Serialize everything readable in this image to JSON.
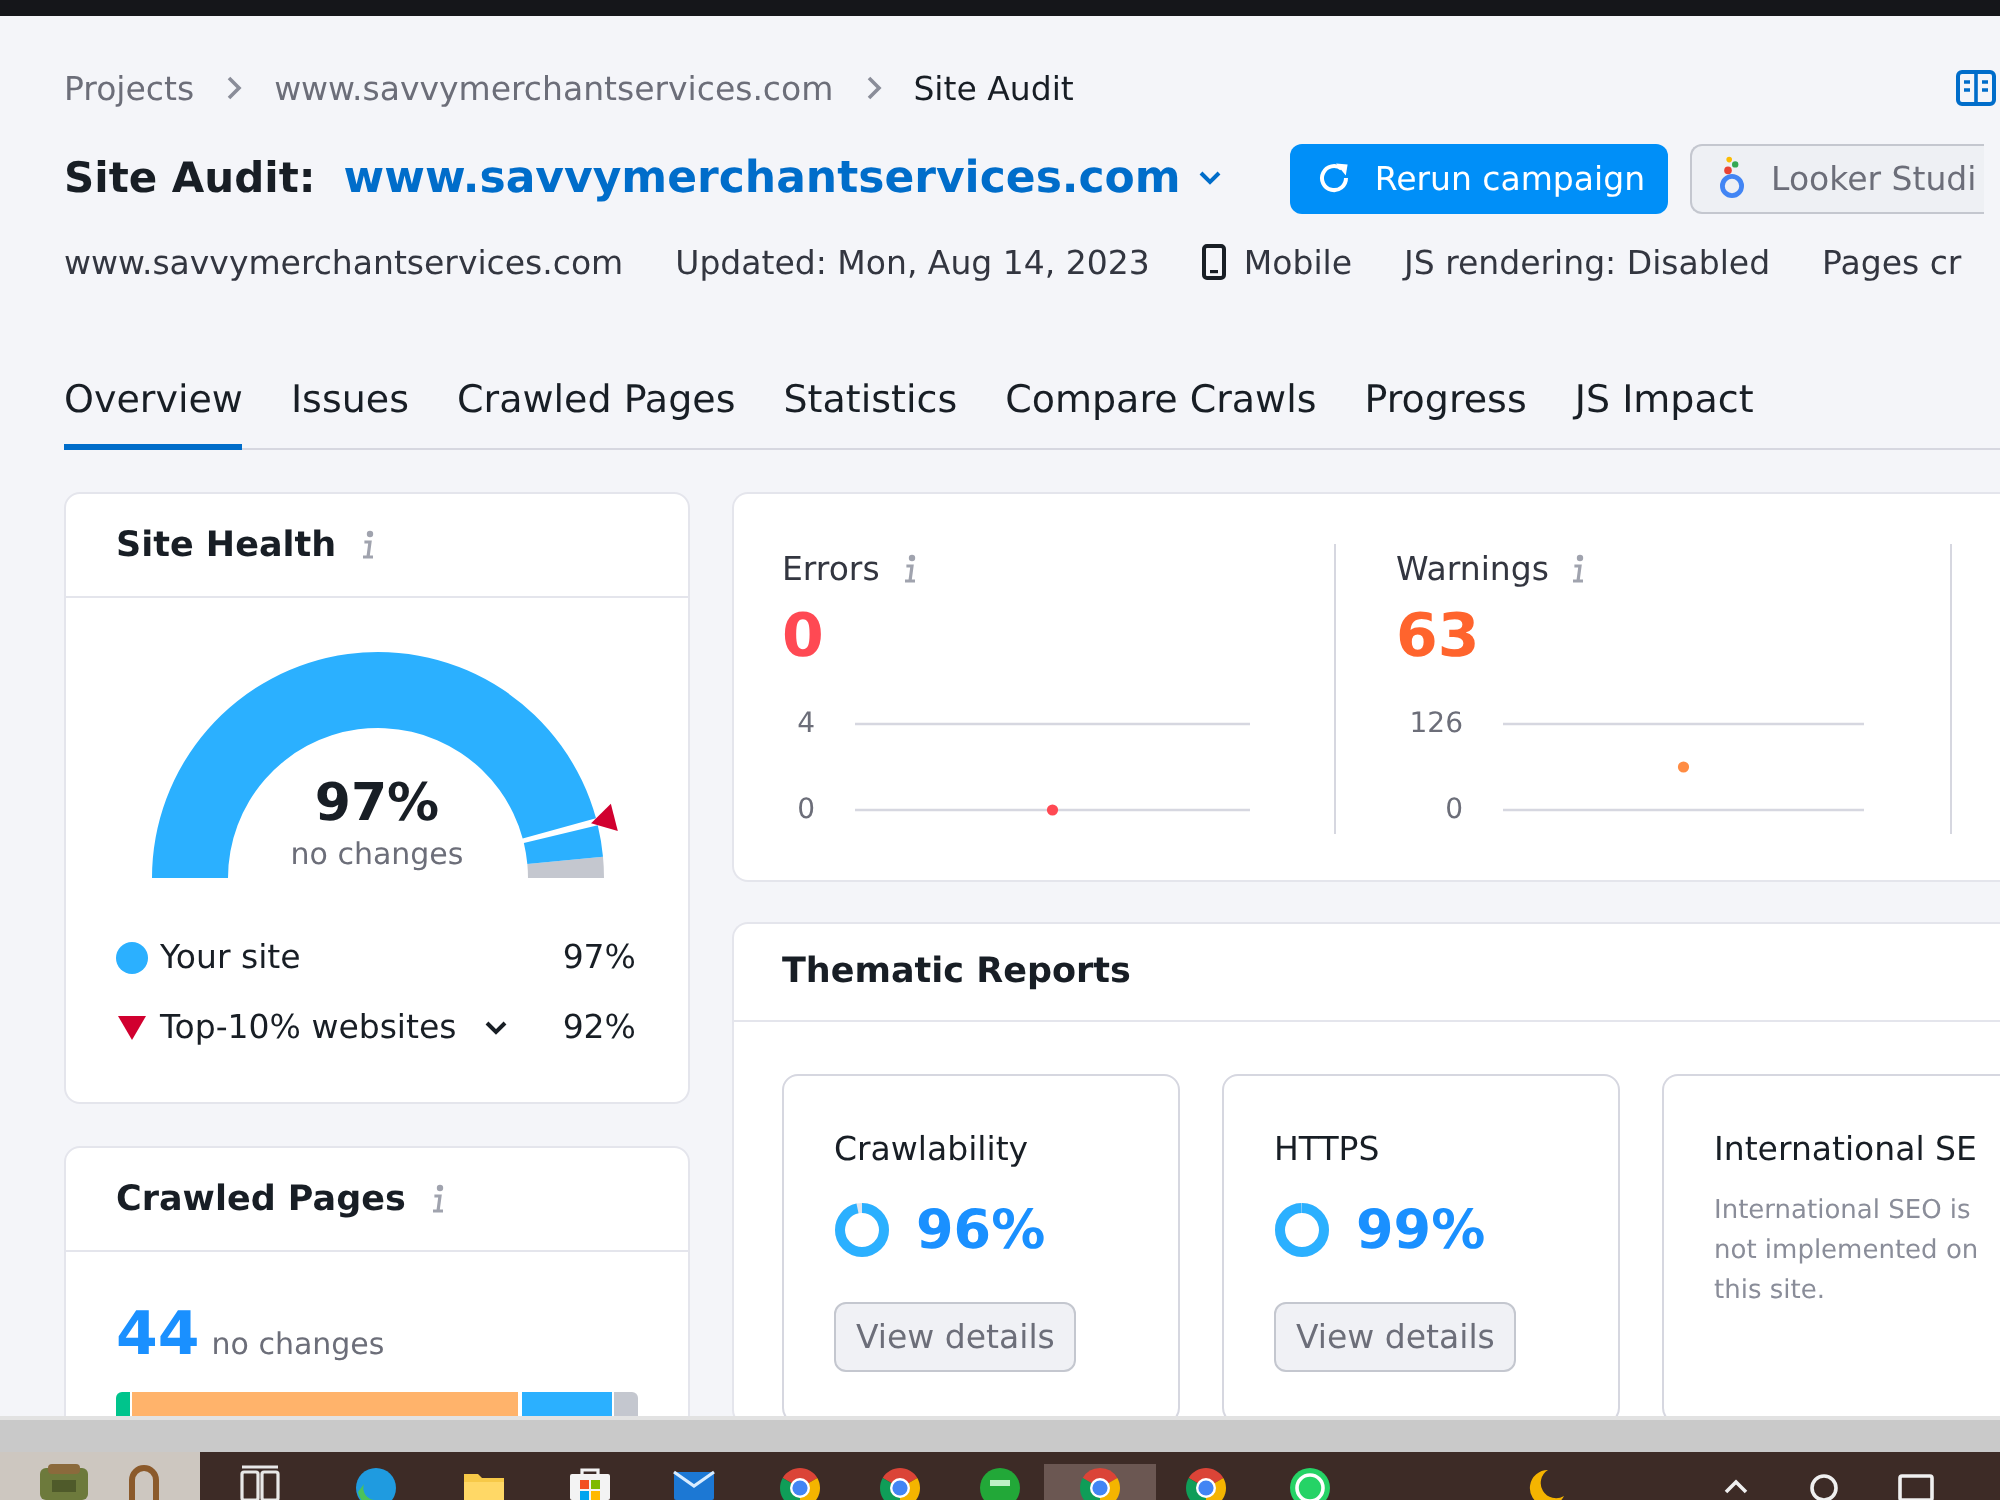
{
  "breadcrumb": [
    {
      "label": "Projects",
      "current": false
    },
    {
      "label": "www.savvymerchantservices.com",
      "current": false
    },
    {
      "label": "Site Audit",
      "current": true
    }
  ],
  "header": {
    "title": "Site Audit:",
    "project": "www.savvymerchantservices.com",
    "buttons": [
      {
        "label": "Rerun campaign",
        "kind": "primary"
      },
      {
        "label": "Looker Studi",
        "kind": "secondary"
      }
    ]
  },
  "meta": [
    {
      "text": "www.savvymerchantservices.com",
      "kind": "text"
    },
    {
      "text": "Updated: Mon, Aug 14, 2023",
      "kind": "text"
    },
    {
      "text": "Mobile",
      "kind": "device"
    },
    {
      "text": "JS rendering: Disabled",
      "kind": "text"
    },
    {
      "text": "Pages cr",
      "kind": "text"
    }
  ],
  "tabs": [
    {
      "label": "Overview",
      "selected": true
    },
    {
      "label": "Issues",
      "selected": false
    },
    {
      "label": "Crawled Pages",
      "selected": false
    },
    {
      "label": "Statistics",
      "selected": false
    },
    {
      "label": "Compare Crawls",
      "selected": false
    },
    {
      "label": "Progress",
      "selected": false
    },
    {
      "label": "JS Impact",
      "selected": false
    }
  ],
  "site_health": {
    "title": "Site Health",
    "value": "97%",
    "change": "no changes",
    "legend": [
      {
        "kind": "dot",
        "label": "Your site",
        "value": "97%",
        "level": 0.97,
        "dropdown": false
      },
      {
        "kind": "marker",
        "label": "Top-10% websites",
        "value": "92%",
        "level": 0.92,
        "dropdown": true
      }
    ]
  },
  "issues": [
    {
      "kind": "error",
      "label": "Errors",
      "value": "0",
      "chart_data": {
        "type": "line",
        "ylim": [
          0,
          4
        ],
        "yticks": [
          0,
          4
        ],
        "series": [
          {
            "color": "#ff4953",
            "marker": true,
            "values": [
              0
            ]
          }
        ]
      }
    },
    {
      "kind": "warning",
      "label": "Warnings",
      "value": "63",
      "chart_data": {
        "type": "line",
        "ylim": [
          0,
          126
        ],
        "yticks": [
          0,
          126
        ],
        "series": [
          {
            "color": "#ff8c43",
            "marker": true,
            "values": [
              63
            ]
          }
        ]
      }
    }
  ],
  "crawled_pages": {
    "title": "Crawled Pages",
    "value": "44",
    "change": "no changes"
  },
  "thematic_reports": {
    "title": "Thematic Reports",
    "reports": [
      {
        "kind": "score",
        "title": "Crawlability",
        "value": "96%",
        "level": 0.96,
        "button": "View details"
      },
      {
        "kind": "score",
        "title": "HTTPS",
        "value": "99%",
        "level": 0.99,
        "button": "View details"
      },
      {
        "kind": "note",
        "title": "International SE",
        "note": "International SEO is not implemented on this site."
      }
    ]
  }
}
